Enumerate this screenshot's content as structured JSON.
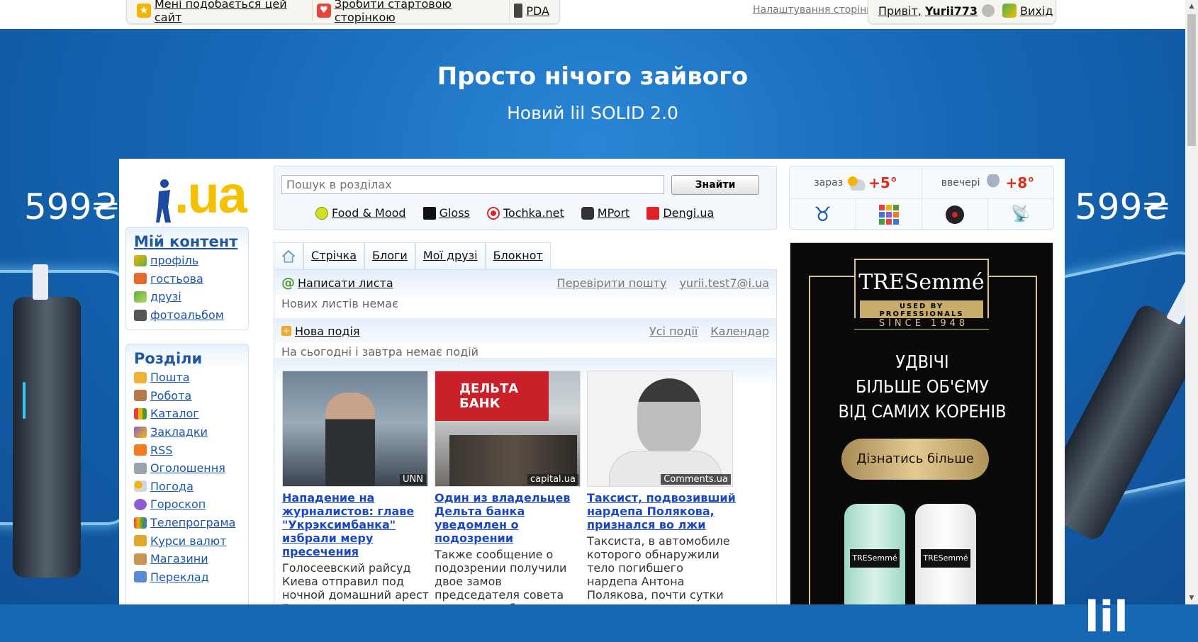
{
  "topbar": {
    "like_site": "Мені подобається цей сайт",
    "make_start": "Зробити стартовою сторінкою",
    "pda": "PDA",
    "settings": "Налаштування сторінки",
    "greeting": "Привіт,",
    "username": "Yurii773",
    "logout": "Вихід"
  },
  "banner": {
    "title": "Просто нічого зайвого",
    "subtitle": "Новий lil SOLID 2.0",
    "price_left": "599₴",
    "price_right": "599₴",
    "brand": "lil"
  },
  "logo": {
    "text": ".ua"
  },
  "search": {
    "placeholder": "Пошук в розділах",
    "button": "Знайти",
    "partners": [
      "Food & Mood",
      "Gloss",
      "Tochka.net",
      "MPort",
      "Dengi.ua"
    ]
  },
  "weather": {
    "now_label": "зараз",
    "now_temp": "+5°",
    "evening_label": "ввечері",
    "evening_temp": "+8°",
    "icons": [
      "taurus-icon",
      "apps-grid-icon",
      "music-disc-icon",
      "radio-tower-icon"
    ]
  },
  "my_content": {
    "title": "Мій контент",
    "items": [
      "профіль",
      "гостьова",
      "друзі",
      "фотоальбом"
    ]
  },
  "sections": {
    "title": "Розділи",
    "items": [
      "Пошта",
      "Робота",
      "Каталог",
      "Закладки",
      "RSS",
      "Оголошення",
      "Погода",
      "Гороскоп",
      "Телепрограма",
      "Курси валют",
      "Магазини",
      "Переклад"
    ]
  },
  "tabs": [
    "Стрічка",
    "Блоги",
    "Мої друзі",
    "Блокнот"
  ],
  "mail": {
    "write": "Написати листа",
    "check": "Перевірити пошту",
    "address": "yurii.test7@i.ua",
    "status": "Нових листів немає"
  },
  "events": {
    "new": "Нова подія",
    "all": "Усі події",
    "calendar": "Календар",
    "status": "На сьогодні і завтра немає подій"
  },
  "news": [
    {
      "source": "UNN",
      "headline": "Нападение на журналистов: главе \"Укрэксимбанка\" избрали меру пресечения",
      "body": "Голосеевский райсуд Киева отправил под ночной домашний арест Евгения"
    },
    {
      "source": "capital.ua",
      "headline": "Один из владельцев Дельта банка уведомлен о подозрении",
      "body": "Также сообщение о подозрении получили двое замов председателя совета директоров банка, а также"
    },
    {
      "source": "Comments.ua",
      "headline": "Таксист, подвозивший нардепа Полякова, признался во лжи",
      "body": "Таксиста, в автомобиле которого обнаружили тело погибшего нардепа Антона Полякова, почти сутки"
    }
  ],
  "news_image_text": "ДЕЛЬТА БАНК",
  "ad": {
    "brand": "TRESemmé",
    "tagline": "USED BY PROFESSIONALS",
    "since": "SINCE 1948",
    "copy": [
      "УДВІЧІ",
      "БІЛЬШЕ ОБ'ЄМУ",
      "ВІД САМИХ КОРЕНІВ"
    ],
    "cta": "Дізнатись більше",
    "bottle_label": "TRESemmé"
  },
  "colors": {
    "banner_blue": "#1667b4",
    "link": "#1a56b0",
    "headline": "#1a48c4",
    "temperature": "#e02a18",
    "ad_gold": "#d8c596",
    "logo_yellow": "#f5c000"
  }
}
